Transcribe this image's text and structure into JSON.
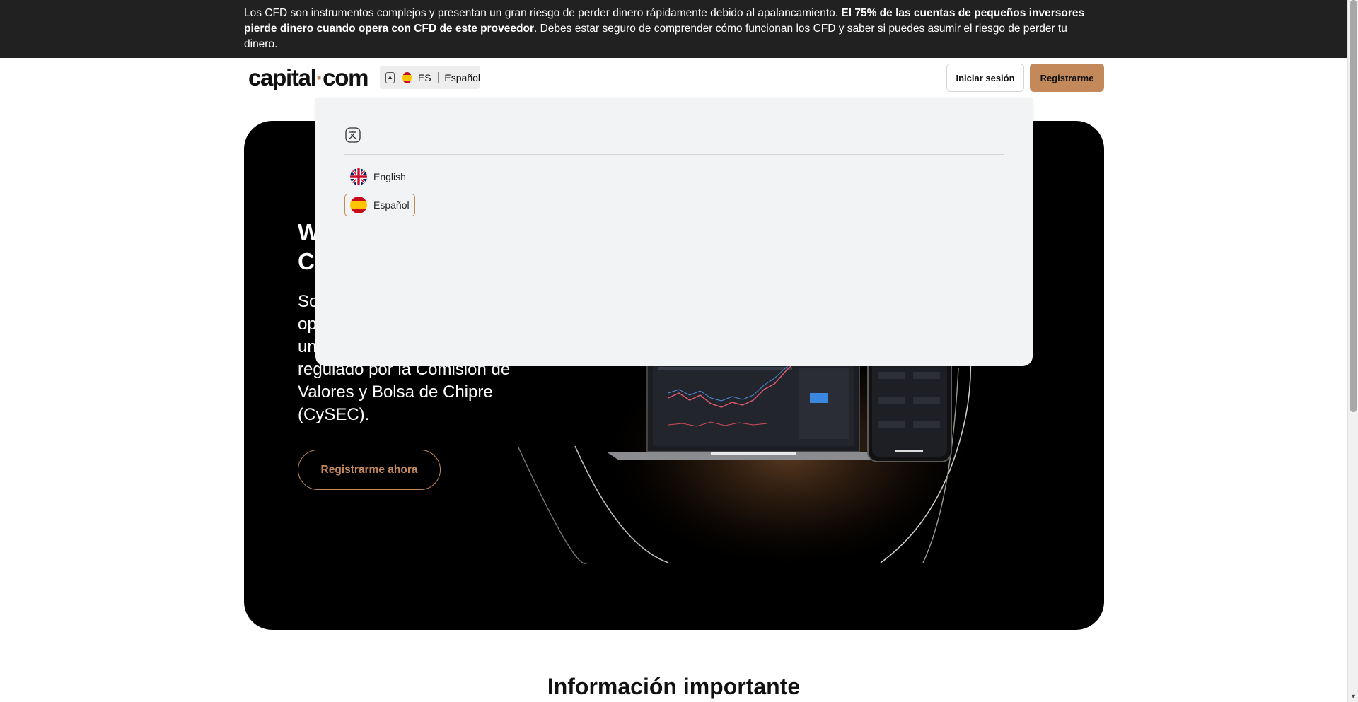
{
  "risk_banner": {
    "text_1": "Los CFD son instrumentos complejos y presentan un gran riesgo de perder dinero rápidamente debido al apalancamiento. ",
    "text_bold": "El 75% de las cuentas de pequeños inversores pierde dinero cuando opera con CFD de este proveedor",
    "text_2": ". Debes estar seguro de comprender cómo funcionan los CFD y saber si puedes asumir el riesgo de perder tu dinero."
  },
  "header": {
    "logo_text_1": "capital",
    "logo_dot": "·",
    "logo_text_2": "com",
    "lang_code": "ES",
    "lang_name": "Español",
    "login_label": "Iniciar sesión",
    "register_label": "Registrarme"
  },
  "hero": {
    "title_visible": "W\nC",
    "description_visible": "So\nop\nun\nregulado por la Comisión de Valores y Bolsa de Chipre (CySEC).",
    "cta_label": "Registrarme ahora"
  },
  "lang_dropdown": {
    "icon": "translate-icon",
    "options": [
      {
        "label": "English",
        "flag": "uk-flag-icon",
        "selected": false
      },
      {
        "label": "Español",
        "flag": "spain-flag-icon",
        "selected": true
      }
    ]
  },
  "important_info": {
    "title": "Información importante"
  },
  "colors": {
    "accent": "#c4895a",
    "banner_bg": "#212121",
    "hero_bg": "#000000",
    "panel_bg": "#f2f3f4"
  }
}
